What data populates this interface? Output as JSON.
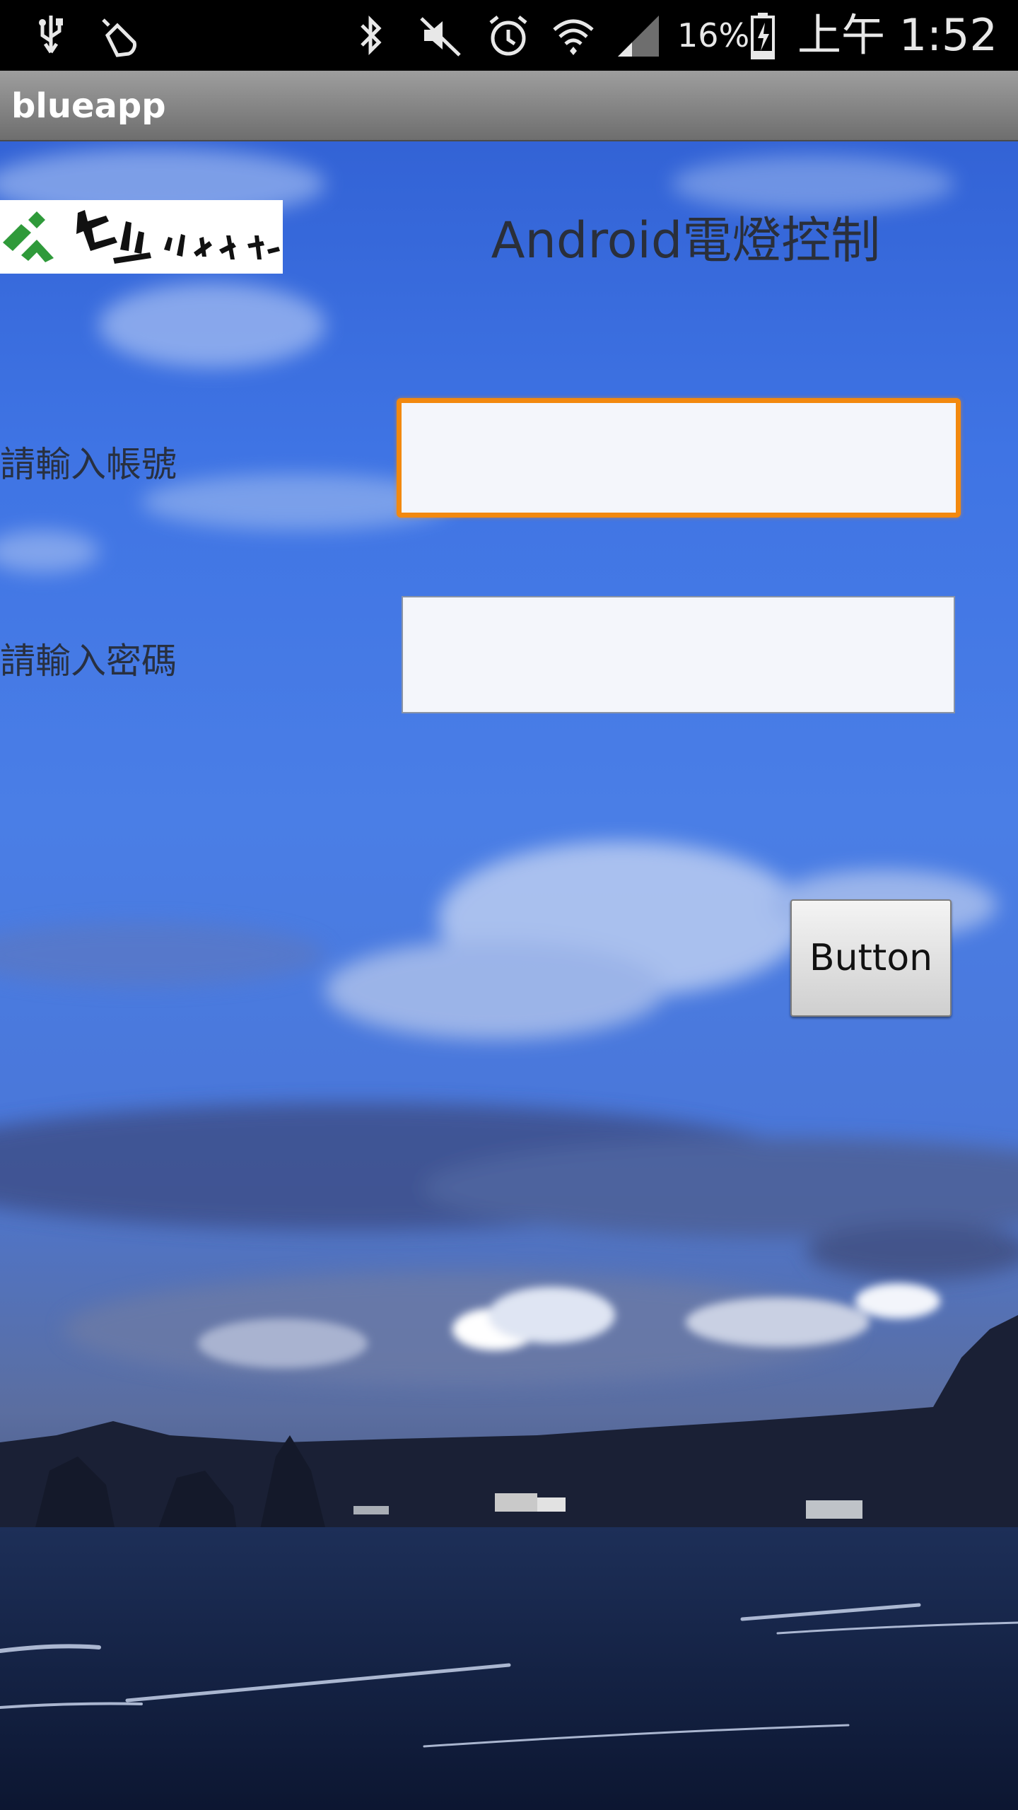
{
  "status_bar": {
    "battery_level": "16%",
    "time": "上午 1:52",
    "icons": [
      "usb-icon",
      "touch-icon",
      "bluetooth-icon",
      "mute-icon",
      "alarm-icon",
      "wifi-icon",
      "signal-icon",
      "battery-charging-icon"
    ]
  },
  "app": {
    "title": "blueapp"
  },
  "main": {
    "heading": "Android電燈控制",
    "logo_name": "school-logo",
    "account_label": "請輸入帳號",
    "account_value": "",
    "password_label": "請輸入密碼",
    "password_value": "",
    "submit_label": "Button"
  },
  "colors": {
    "focus_border": "#f2890f",
    "input_bg": "#f4f6fb",
    "title_bar": "#8a8a8a"
  }
}
